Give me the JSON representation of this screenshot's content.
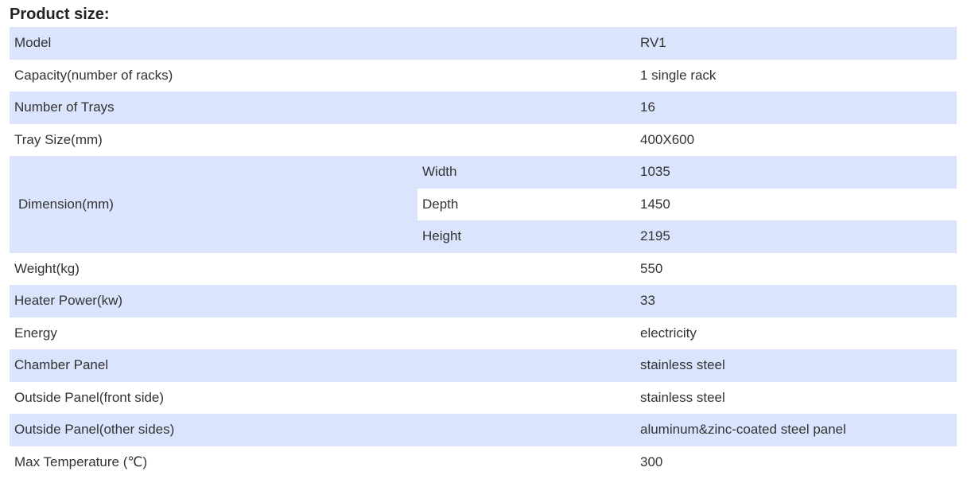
{
  "title": "Product size:",
  "rows": [
    {
      "label": "Model",
      "value": "RV1"
    },
    {
      "label": "Capacity(number of racks)",
      "value": "1 single rack"
    },
    {
      "label": "Number of Trays",
      "value": "16"
    },
    {
      "label": "Tray Size(mm)",
      "value": "400X600"
    }
  ],
  "dimension": {
    "label": "Dimension(mm)",
    "rows": [
      {
        "label": "Width",
        "value": "1035"
      },
      {
        "label": "Depth",
        "value": "1450"
      },
      {
        "label": "Height",
        "value": "2195"
      }
    ]
  },
  "rows_after": [
    {
      "label": "Weight(kg)",
      "value": "550"
    },
    {
      "label": "Heater Power(kw)",
      "value": "33"
    },
    {
      "label": "Energy",
      "value": "electricity"
    },
    {
      "label": "Chamber Panel",
      "value": "stainless steel"
    },
    {
      "label": "Outside Panel(front side)",
      "value": "stainless steel"
    },
    {
      "label": "Outside Panel(other sides)",
      "value": "aluminum&zinc-coated steel panel"
    },
    {
      "label": "Max Temperature (℃)",
      "value": "300"
    }
  ],
  "colors": {
    "stripe": "#dbe4fd",
    "text": "#333333"
  }
}
